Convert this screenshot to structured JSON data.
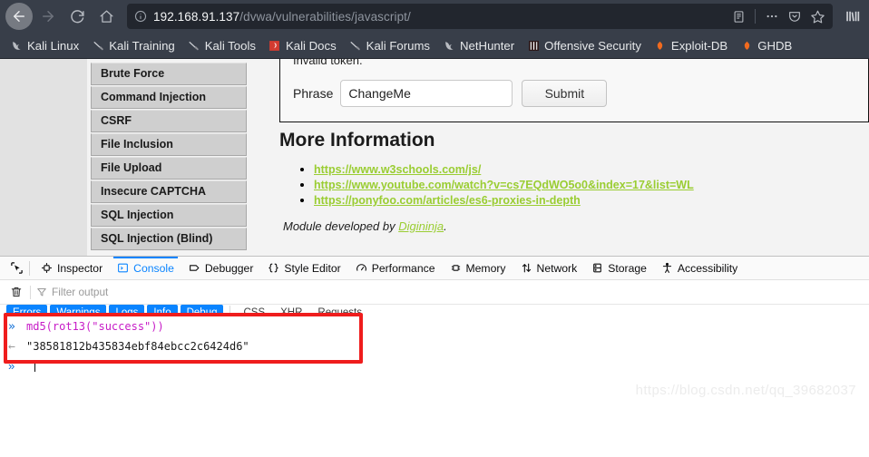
{
  "browser": {
    "nav": {
      "back_label": "Back",
      "forward_label": "Forward",
      "reload_label": "Reload",
      "home_label": "Home"
    },
    "url": {
      "host": "192.168.91.137",
      "path": "/dvwa/vulnerabilities/javascript/",
      "security_icon": "info-icon",
      "reader_label": "Reader View",
      "more_label": "Page actions",
      "pocket_label": "Save to Pocket",
      "bookmark_label": "Bookmark this page",
      "library_label": "Library"
    },
    "bookmarks": [
      {
        "label": "Kali Linux",
        "icon": "kali-dragon-icon"
      },
      {
        "label": "Kali Training",
        "icon": "kali-training-icon"
      },
      {
        "label": "Kali Tools",
        "icon": "kali-tools-icon"
      },
      {
        "label": "Kali Docs",
        "icon": "kali-docs-icon"
      },
      {
        "label": "Kali Forums",
        "icon": "kali-forums-icon"
      },
      {
        "label": "NetHunter",
        "icon": "kali-dragon-icon"
      },
      {
        "label": "Offensive Security",
        "icon": "offensive-security-icon"
      },
      {
        "label": "Exploit-DB",
        "icon": "exploit-db-icon"
      },
      {
        "label": "GHDB",
        "icon": "ghdb-icon"
      }
    ]
  },
  "page": {
    "sidebar": {
      "items": [
        {
          "label": "Brute Force"
        },
        {
          "label": "Command Injection"
        },
        {
          "label": "CSRF"
        },
        {
          "label": "File Inclusion"
        },
        {
          "label": "File Upload"
        },
        {
          "label": "Insecure CAPTCHA"
        },
        {
          "label": "SQL Injection"
        },
        {
          "label": "SQL Injection (Blind)"
        }
      ]
    },
    "form": {
      "message": "Invalid token.",
      "phrase_label": "Phrase",
      "phrase_value": "ChangeMe",
      "phrase_placeholder": "",
      "submit_label": "Submit"
    },
    "more_information": {
      "heading": "More Information",
      "links": [
        "https://www.w3schools.com/js/",
        "https://www.youtube.com/watch?v=cs7EQdWO5o0&index=17&list=WL",
        "https://ponyfoo.com/articles/es6-proxies-in-depth"
      ],
      "credit_prefix": "Module developed by ",
      "credit_link": "Digininja",
      "credit_suffix": "."
    }
  },
  "devtools": {
    "picker_label": "Pick an element from the page",
    "tabs": [
      {
        "label": "Inspector",
        "icon": "inspector-icon",
        "active": false
      },
      {
        "label": "Console",
        "icon": "console-icon",
        "active": true
      },
      {
        "label": "Debugger",
        "icon": "debugger-icon",
        "active": false
      },
      {
        "label": "Style Editor",
        "icon": "style-editor-icon",
        "active": false
      },
      {
        "label": "Performance",
        "icon": "performance-icon",
        "active": false
      },
      {
        "label": "Memory",
        "icon": "memory-icon",
        "active": false
      },
      {
        "label": "Network",
        "icon": "network-icon",
        "active": false
      },
      {
        "label": "Storage",
        "icon": "storage-icon",
        "active": false
      },
      {
        "label": "Accessibility",
        "icon": "accessibility-icon",
        "active": false
      }
    ],
    "filter_bar": {
      "clear_label": "Clear console output",
      "filter_placeholder": "Filter output",
      "filter_value": ""
    },
    "filter_pills": [
      {
        "label": "Errors",
        "active": true
      },
      {
        "label": "Warnings",
        "active": true
      },
      {
        "label": "Logs",
        "active": true
      },
      {
        "label": "Info",
        "active": true
      },
      {
        "label": "Debug",
        "active": true
      },
      {
        "label": "CSS",
        "active": false
      },
      {
        "label": "XHR",
        "active": false
      },
      {
        "label": "Requests",
        "active": false
      }
    ],
    "console": {
      "input_arrow": "»",
      "output_arrow": "←",
      "input_expression": "md5(rot13(\"success\"))",
      "output_value": "\"38581812b435834ebf84ebcc2c6424d6\"",
      "prompt_arrow": "»",
      "prompt_value": ""
    },
    "annotation": {
      "type": "red-rectangle",
      "color": "#ef1d1d"
    }
  },
  "watermark": "https://blog.csdn.net/qq_39682037",
  "colors": {
    "chrome_bg": "#383e49",
    "urlbar_bg": "#22262e",
    "accent_blue": "#0a84ff",
    "link_green": "#9acd32",
    "annotation_red": "#ef1d1d"
  }
}
